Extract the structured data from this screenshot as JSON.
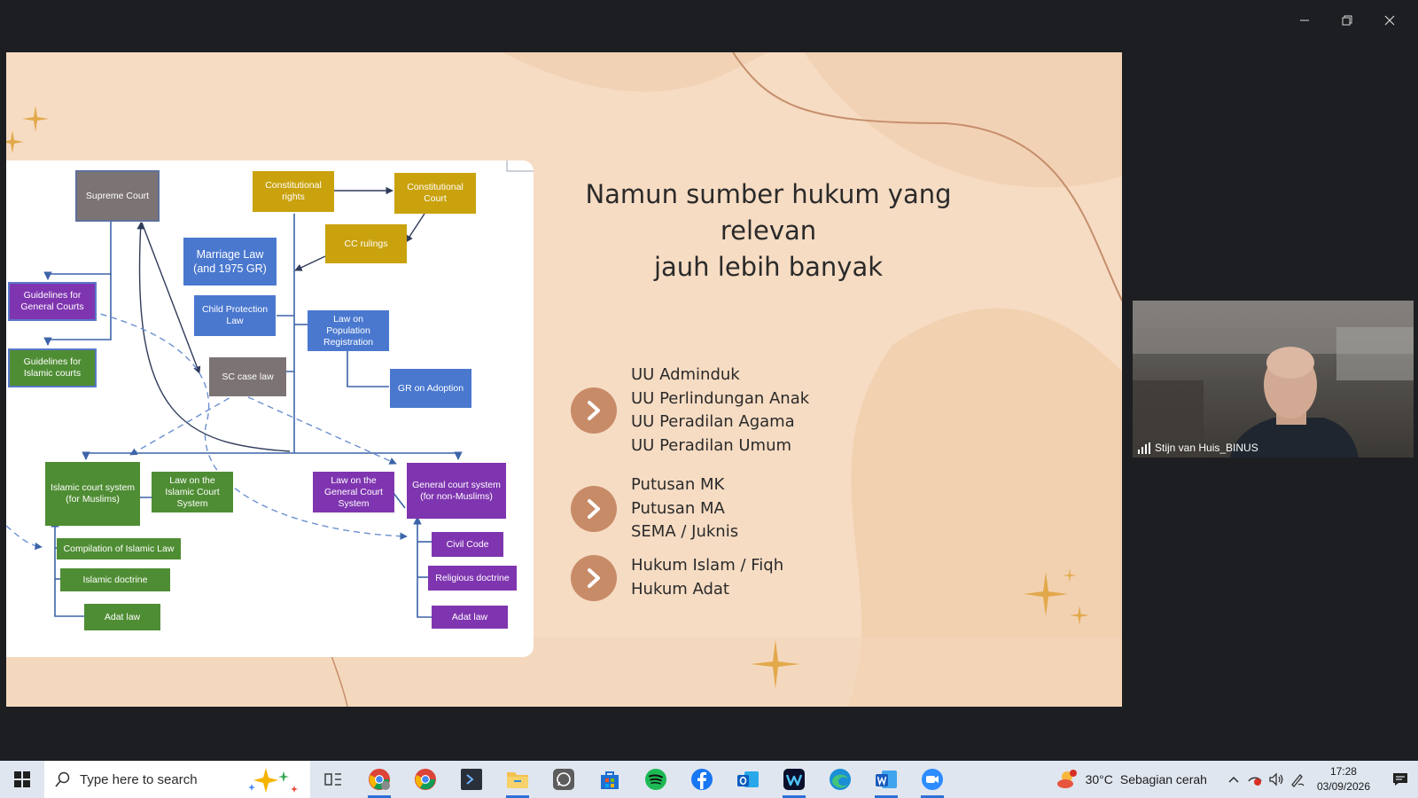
{
  "window_controls": {
    "minimize": "─",
    "restore": "❐",
    "close": "✕"
  },
  "slide": {
    "title_lines": [
      "Namun sumber hukum yang",
      "relevan",
      "jauh lebih banyak"
    ],
    "bullet_groups": [
      [
        "UU Adminduk",
        "UU Perlindungan Anak",
        "UU Peradilan Agama",
        "UU Peradilan Umum"
      ],
      [
        "Putusan MK",
        "Putusan MA",
        "SEMA / Juknis"
      ],
      [
        "Hukum Islam / Fiqh",
        "Hukum Adat"
      ]
    ],
    "accent_color": "#c88b68",
    "background_color": "#f6dcc3",
    "diagram": {
      "supreme_court": "Supreme Court",
      "constitutional_rights": "Constitutional\nrights",
      "constitutional_court": "Constitutional\nCourt",
      "cc_rulings": "CC rulings",
      "marriage_law": "Marriage Law\n(and 1975 GR)",
      "child_protection": "Child Protection\nLaw",
      "population_registration": "Law on\nPopulation\nRegistration",
      "gr_adoption": "GR on Adoption",
      "sc_case_law": "SC case law",
      "guidelines_general": "Guidelines for\nGeneral Courts",
      "guidelines_islamic": "Guidelines for\nIslamic courts",
      "islamic_court_system": "Islamic court system\n(for Muslims)",
      "law_islamic_court": "Law on the\nIslamic Court\nSystem",
      "law_general_court": "Law on the\nGeneral Court\nSystem",
      "general_court_system": "General court system\n(for non-Muslims)",
      "compilation_islamic_law": "Compilation of Islamic Law",
      "islamic_doctrine": "Islamic doctrine",
      "adat_law_left": "Adat law",
      "civil_code": "Civil Code",
      "religious_doctrine": "Religious doctrine",
      "adat_law_right": "Adat law"
    }
  },
  "video": {
    "participant_name": "Stijn van Huis_BINUS"
  },
  "taskbar": {
    "search_placeholder": "Type here to search",
    "apps": [
      "task-view",
      "chrome-profile",
      "chrome",
      "powershell",
      "file-explorer",
      "whatsapp",
      "microsoft-store",
      "spotify",
      "facebook",
      "outlook",
      "webex",
      "edge",
      "word",
      "zoom"
    ],
    "weather_temp": "30°C",
    "weather_desc": "Sebagian cerah",
    "time": "17:28",
    "date": "03/09/2026"
  }
}
